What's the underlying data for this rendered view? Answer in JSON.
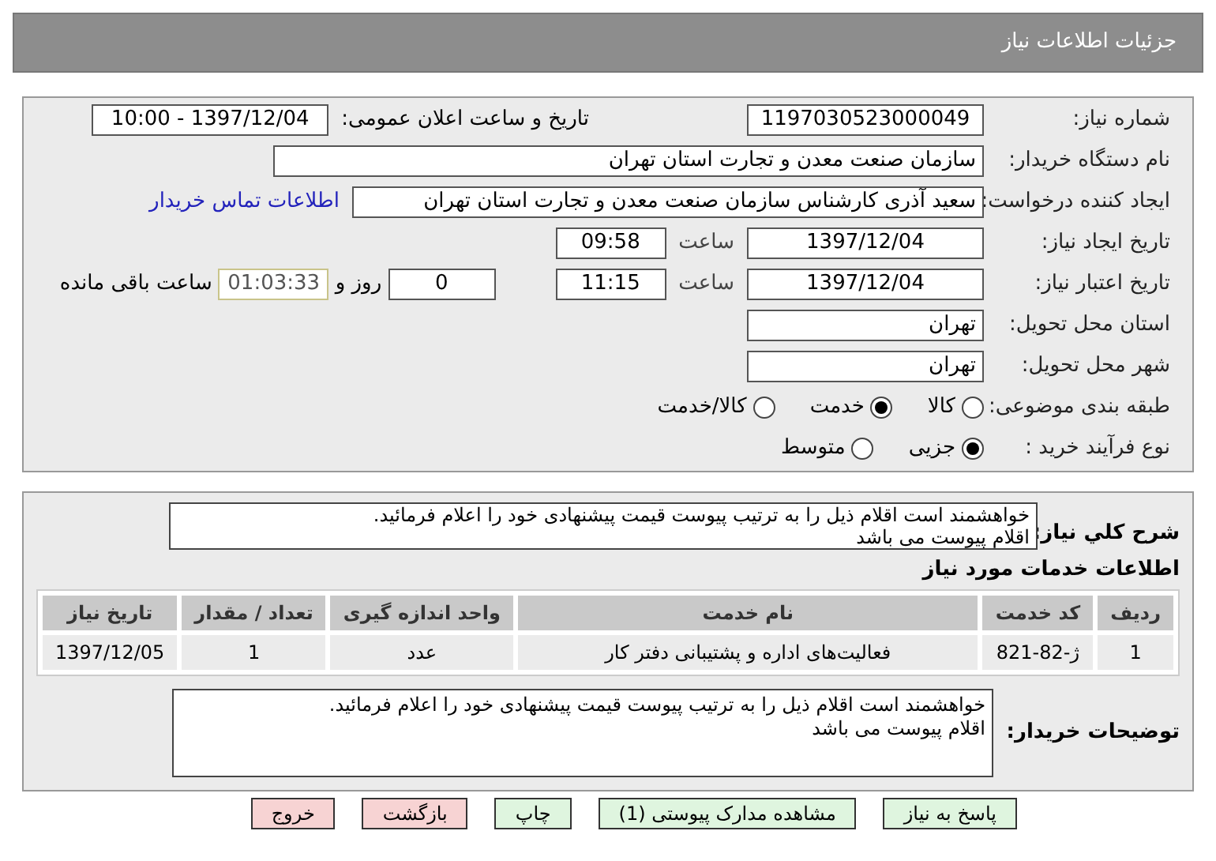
{
  "header": {
    "title": "جزئیات اطلاعات نیاز"
  },
  "details": {
    "need_number": {
      "label": "شماره نیاز:",
      "value": "1197030523000049"
    },
    "announce": {
      "label": "تاریخ و ساعت اعلان عمومی:",
      "value": "1397/12/04 - 10:00"
    },
    "buyer_org": {
      "label": "نام دستگاه خریدار:",
      "value": "سازمان صنعت معدن و تجارت استان تهران"
    },
    "requester": {
      "label": "ایجاد کننده درخواست:",
      "value": "سعید آذری کارشناس سازمان صنعت معدن و تجارت استان تهران",
      "link": "اطلاعات تماس خریدار"
    },
    "created": {
      "label": "تاریخ ایجاد نیاز:",
      "date": "1397/12/04",
      "time_label": "ساعت",
      "time": "09:58"
    },
    "validity": {
      "label": "تاریخ اعتبار نیاز:",
      "date": "1397/12/04",
      "time_label": "ساعت",
      "time": "11:15",
      "days": "0",
      "days_label": "روز و",
      "remaining": "01:03:33",
      "remaining_label": "ساعت باقی مانده"
    },
    "province": {
      "label": "استان محل تحویل:",
      "value": "تهران"
    },
    "city": {
      "label": "شهر محل تحویل:",
      "value": "تهران"
    },
    "category": {
      "label": "طبقه بندی موضوعی:",
      "options": [
        {
          "label": "کالا",
          "selected": false
        },
        {
          "label": "خدمت",
          "selected": true
        },
        {
          "label": "کالا/خدمت",
          "selected": false
        }
      ]
    },
    "process": {
      "label": "نوع فرآیند خرید :",
      "options": [
        {
          "label": "جزیی",
          "selected": true
        },
        {
          "label": "متوسط",
          "selected": false
        }
      ]
    }
  },
  "summary": {
    "label": "شرح کلي نیاز:",
    "lines": [
      "خواهشمند است اقلام ذیل را به  ترتیب پیوست قیمت پیشنهادی خود را اعلام فرمائید.",
      "اقلام پیوست می باشد"
    ]
  },
  "services": {
    "title": "اطلاعات خدمات مورد نیاز",
    "columns": [
      "ردیف",
      "کد خدمت",
      "نام خدمت",
      "واحد اندازه گیری",
      "تعداد / مقدار",
      "تاریخ نیاز"
    ],
    "rows": [
      [
        "1",
        "ژ-82-821",
        "فعالیت‌های اداره و پشتیبانی دفتر کار",
        "عدد",
        "1",
        "1397/12/05"
      ]
    ]
  },
  "buyer_notes": {
    "label": "توضیحات خریدار:",
    "lines": [
      "خواهشمند است اقلام ذیل را به  ترتیب پیوست قیمت پیشنهادی خود را اعلام فرمائید.",
      "اقلام پیوست می باشد"
    ]
  },
  "buttons": [
    {
      "label": "پاسخ به نیاز",
      "kind": "primary"
    },
    {
      "label": "مشاهده مدارک پیوستی (1)",
      "kind": "primary"
    },
    {
      "label": "چاپ",
      "kind": "primary"
    },
    {
      "label": "بازگشت",
      "kind": "danger"
    },
    {
      "label": "خروج",
      "kind": "danger"
    }
  ]
}
